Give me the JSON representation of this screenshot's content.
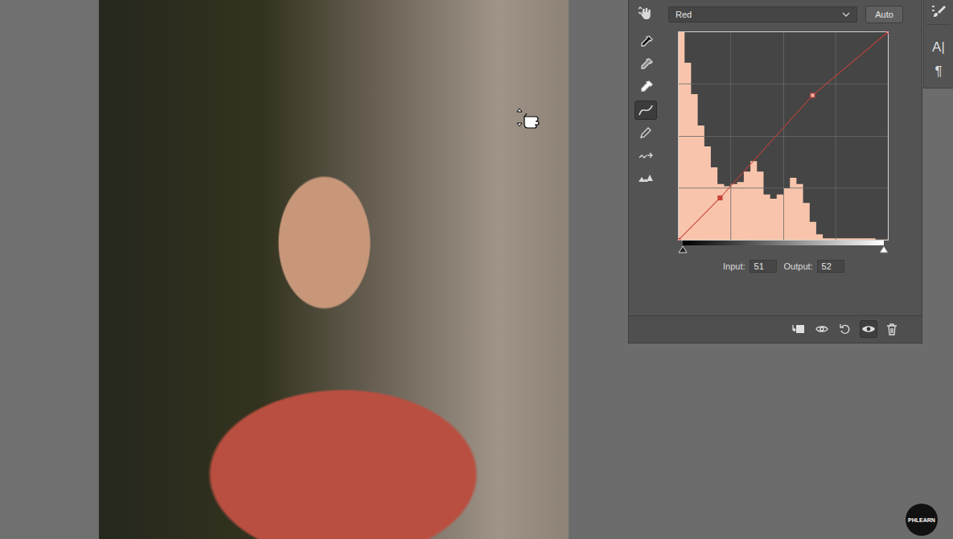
{
  "panel": {
    "channel": "Red",
    "auto_button": "Auto",
    "tools": [
      {
        "kind": "target",
        "selected": false
      },
      {
        "kind": "eyedropper-black",
        "selected": false
      },
      {
        "kind": "eyedropper-gray",
        "selected": false
      },
      {
        "kind": "eyedropper-white",
        "selected": false
      },
      {
        "kind": "curve",
        "selected": true
      },
      {
        "kind": "pencil",
        "selected": false
      },
      {
        "kind": "smooth",
        "selected": false
      },
      {
        "kind": "clipping",
        "selected": false
      }
    ],
    "curve": {
      "points": [
        {
          "input": 0,
          "output": 0,
          "selected": false
        },
        {
          "input": 51,
          "output": 52,
          "selected": true
        },
        {
          "input": 163,
          "output": 177,
          "selected": false
        },
        {
          "input": 255,
          "output": 255,
          "selected": false
        }
      ],
      "histogram": [
        1.0,
        0.85,
        0.7,
        0.55,
        0.45,
        0.35,
        0.27,
        0.26,
        0.27,
        0.28,
        0.33,
        0.38,
        0.33,
        0.22,
        0.2,
        0.22,
        0.25,
        0.3,
        0.27,
        0.18,
        0.09,
        0.03,
        0.01,
        0.01,
        0.01,
        0.01,
        0.01,
        0.01,
        0.01,
        0.01,
        0.005,
        0.005
      ]
    },
    "input": {
      "label": "Input:",
      "value": "51"
    },
    "output": {
      "label": "Output:",
      "value": "52"
    },
    "footer_buttons": [
      {
        "kind": "clip"
      },
      {
        "kind": "view-previous"
      },
      {
        "kind": "reset"
      },
      {
        "kind": "visibility"
      },
      {
        "kind": "delete"
      }
    ]
  },
  "side_strip": {
    "icons": [
      {
        "kind": "brush",
        "glyph": ""
      },
      {
        "kind": "character",
        "glyph": "A|"
      },
      {
        "kind": "paragraph",
        "glyph": "¶"
      }
    ]
  },
  "watermark": "PHLEARN"
}
